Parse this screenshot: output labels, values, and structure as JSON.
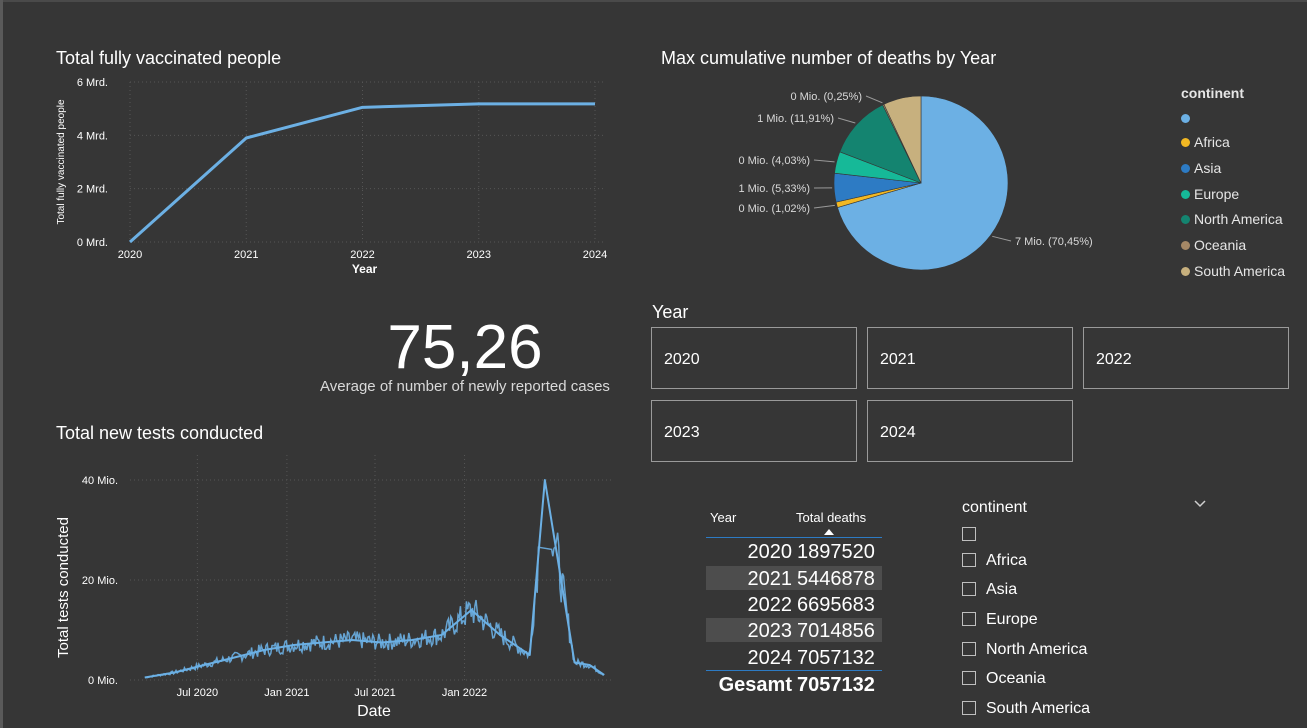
{
  "vaccinated": {
    "title": "Total fully vaccinated people",
    "chart_data": {
      "type": "line",
      "title": "Total fully vaccinated people",
      "xlabel": "Year",
      "ylabel": "Total fully vaccinated people",
      "x": [
        2020,
        2021,
        2022,
        2023,
        2024
      ],
      "values": [
        0,
        3.9,
        5.05,
        5.18,
        5.18
      ],
      "unit": "Mrd.",
      "ylim": [
        0,
        6
      ],
      "yticks": [
        "0 Mrd.",
        "2 Mrd.",
        "4 Mrd.",
        "6 Mrd."
      ],
      "xticks": [
        "2020",
        "2021",
        "2022",
        "2023",
        "2024"
      ],
      "grid": true,
      "color": "#6cb0e4"
    }
  },
  "deaths_pie": {
    "title": "Max cumulative number of deaths by Year",
    "chart_data": {
      "type": "pie",
      "title": "Max cumulative number of deaths by Year",
      "slices": [
        {
          "name": "",
          "percent": 70.45,
          "label": "7 Mio. (70,45%)",
          "color": "#6cb0e4"
        },
        {
          "name": "Africa",
          "percent": 1.02,
          "label": "0 Mio. (1,02%)",
          "color": "#f2b823"
        },
        {
          "name": "Asia",
          "percent": 5.33,
          "label": "1 Mio. (5,33%)",
          "color": "#2d7bc4"
        },
        {
          "name": "Europe",
          "percent": 4.03,
          "label": "0 Mio. (4,03%)",
          "color": "#16b998"
        },
        {
          "name": "North America",
          "percent": 11.91,
          "label": "1 Mio. (11,91%)",
          "color": "#148470"
        },
        {
          "name": "Oceania",
          "percent": 0.25,
          "label": "0 Mio. (0,25%)",
          "color": "#a58866"
        },
        {
          "name": "South America",
          "percent": 7.01,
          "label": "",
          "color": "#c7b07e"
        }
      ]
    },
    "legend_title": "continent",
    "legend": [
      {
        "name": "",
        "color": "#6cb0e4"
      },
      {
        "name": "Africa",
        "color": "#f2b823"
      },
      {
        "name": "Asia",
        "color": "#2d7bc4"
      },
      {
        "name": "Europe",
        "color": "#16b998"
      },
      {
        "name": "North America",
        "color": "#148470"
      },
      {
        "name": "Oceania",
        "color": "#a58866"
      },
      {
        "name": "South America",
        "color": "#c7b07e"
      }
    ]
  },
  "kpi": {
    "value": "75,26",
    "label": "Average of number of newly reported cases"
  },
  "year_slicer": {
    "title": "Year",
    "tiles": [
      "2020",
      "2021",
      "2022",
      "2023",
      "2024"
    ]
  },
  "tests": {
    "title": "Total new tests conducted",
    "chart_data": {
      "type": "line",
      "title": "Total new tests conducted",
      "xlabel": "Date",
      "ylabel": "Total tests conducted",
      "unit": "Mio.",
      "ylim": [
        0,
        45
      ],
      "yticks": [
        "0 Mio.",
        "20 Mio.",
        "40 Mio."
      ],
      "xticks": [
        "Jul 2020",
        "Jan 2021",
        "Jul 2021",
        "Jan 2022"
      ],
      "grid": true,
      "color": "#6cb0e4",
      "x": [
        "2020-03",
        "2020-05",
        "2020-07",
        "2020-09",
        "2020-11",
        "2021-01",
        "2021-03",
        "2021-05",
        "2021-07",
        "2021-09",
        "2021-11",
        "2022-01",
        "2022-03",
        "2022-05",
        "2022-06",
        "2022-08",
        "2022-09",
        "2022-10"
      ],
      "y": [
        0.5,
        1.5,
        3,
        4.5,
        6,
        7,
        7.5,
        8,
        7.5,
        8,
        9,
        14,
        9,
        5,
        40,
        3.5,
        3,
        1
      ]
    }
  },
  "deaths_table": {
    "headers": [
      "Year",
      "Total deaths"
    ],
    "rows": [
      {
        "year": "2020",
        "total": "1897520"
      },
      {
        "year": "2021",
        "total": "5446878"
      },
      {
        "year": "2022",
        "total": "6695683"
      },
      {
        "year": "2023",
        "total": "7014856"
      },
      {
        "year": "2024",
        "total": "7057132"
      }
    ],
    "total_label": "Gesamt",
    "total_value": "7057132"
  },
  "continent_slicer": {
    "title": "continent",
    "chevron_icon": "chevron-down-icon",
    "items": [
      "",
      "Africa",
      "Asia",
      "Europe",
      "North America",
      "Oceania",
      "South America"
    ]
  }
}
